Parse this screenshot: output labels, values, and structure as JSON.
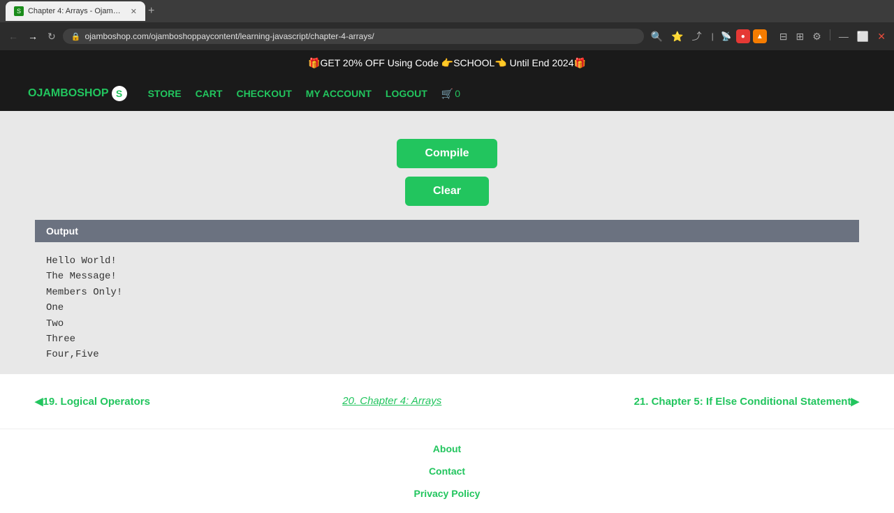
{
  "browser": {
    "tab_title": "Chapter 4: Arrays - Ojamb...",
    "url": "ojamboshop.com/ojamboshoppaycontent/learning-javascript/chapter-4-arrays/",
    "favicon_text": "S"
  },
  "promo": {
    "text": "🎁GET 20% OFF Using Code 👉SCHOOL👈 Until End 2024🎁"
  },
  "nav": {
    "logo": "OJAMBOSHOP",
    "logo_s": "S",
    "store": "STORE",
    "cart": "CART",
    "checkout": "CHECKOUT",
    "my_account": "MY ACCOUNT",
    "logout": "LOGOUT",
    "cart_count": "0"
  },
  "buttons": {
    "compile": "Compile",
    "clear": "Clear"
  },
  "output": {
    "header": "Output",
    "lines": [
      "Hello World!",
      "The Message!",
      "Members Only!",
      "One",
      "Two",
      "Three",
      "Four,Five"
    ]
  },
  "chapter_nav": {
    "prev_label": "◀19. Logical Operators",
    "current_label": "20. Chapter 4: Arrays",
    "next_label": "21. Chapter 5: If Else Conditional Statement▶"
  },
  "footer": {
    "about": "About",
    "contact": "Contact",
    "privacy": "Privacy Policy"
  }
}
